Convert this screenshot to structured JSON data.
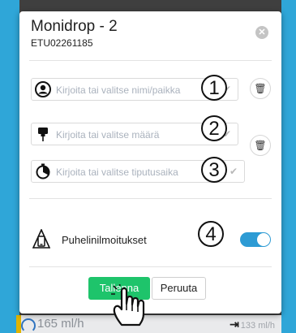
{
  "dialog": {
    "title": "Monidrop - 2",
    "subtitle": "ETU02261185",
    "close_icon": "x-icon"
  },
  "fields": {
    "name": {
      "placeholder": "Kirjoita tai valitse nimi/paikka",
      "icon": "person-icon"
    },
    "amount": {
      "placeholder": "Kirjoita tai valitse määrä",
      "icon": "iv-bag-icon"
    },
    "drip_rate": {
      "placeholder": "Kirjoita tai valitse tiputusaika",
      "icon": "timer-icon"
    }
  },
  "callouts": [
    "1",
    "2",
    "3",
    "4"
  ],
  "notifications": {
    "label": "Puhelinilmoitukset",
    "enabled": true,
    "icon": "phone-icon"
  },
  "actions": {
    "save": "Tallenna",
    "cancel": "Peruuta"
  },
  "background": {
    "flow_rate": "165 ml/h",
    "target_rate": "133 ml/h"
  },
  "colors": {
    "accent": "#2d9bd4",
    "save": "#1ec46b",
    "frame": "#2fa6d8"
  }
}
